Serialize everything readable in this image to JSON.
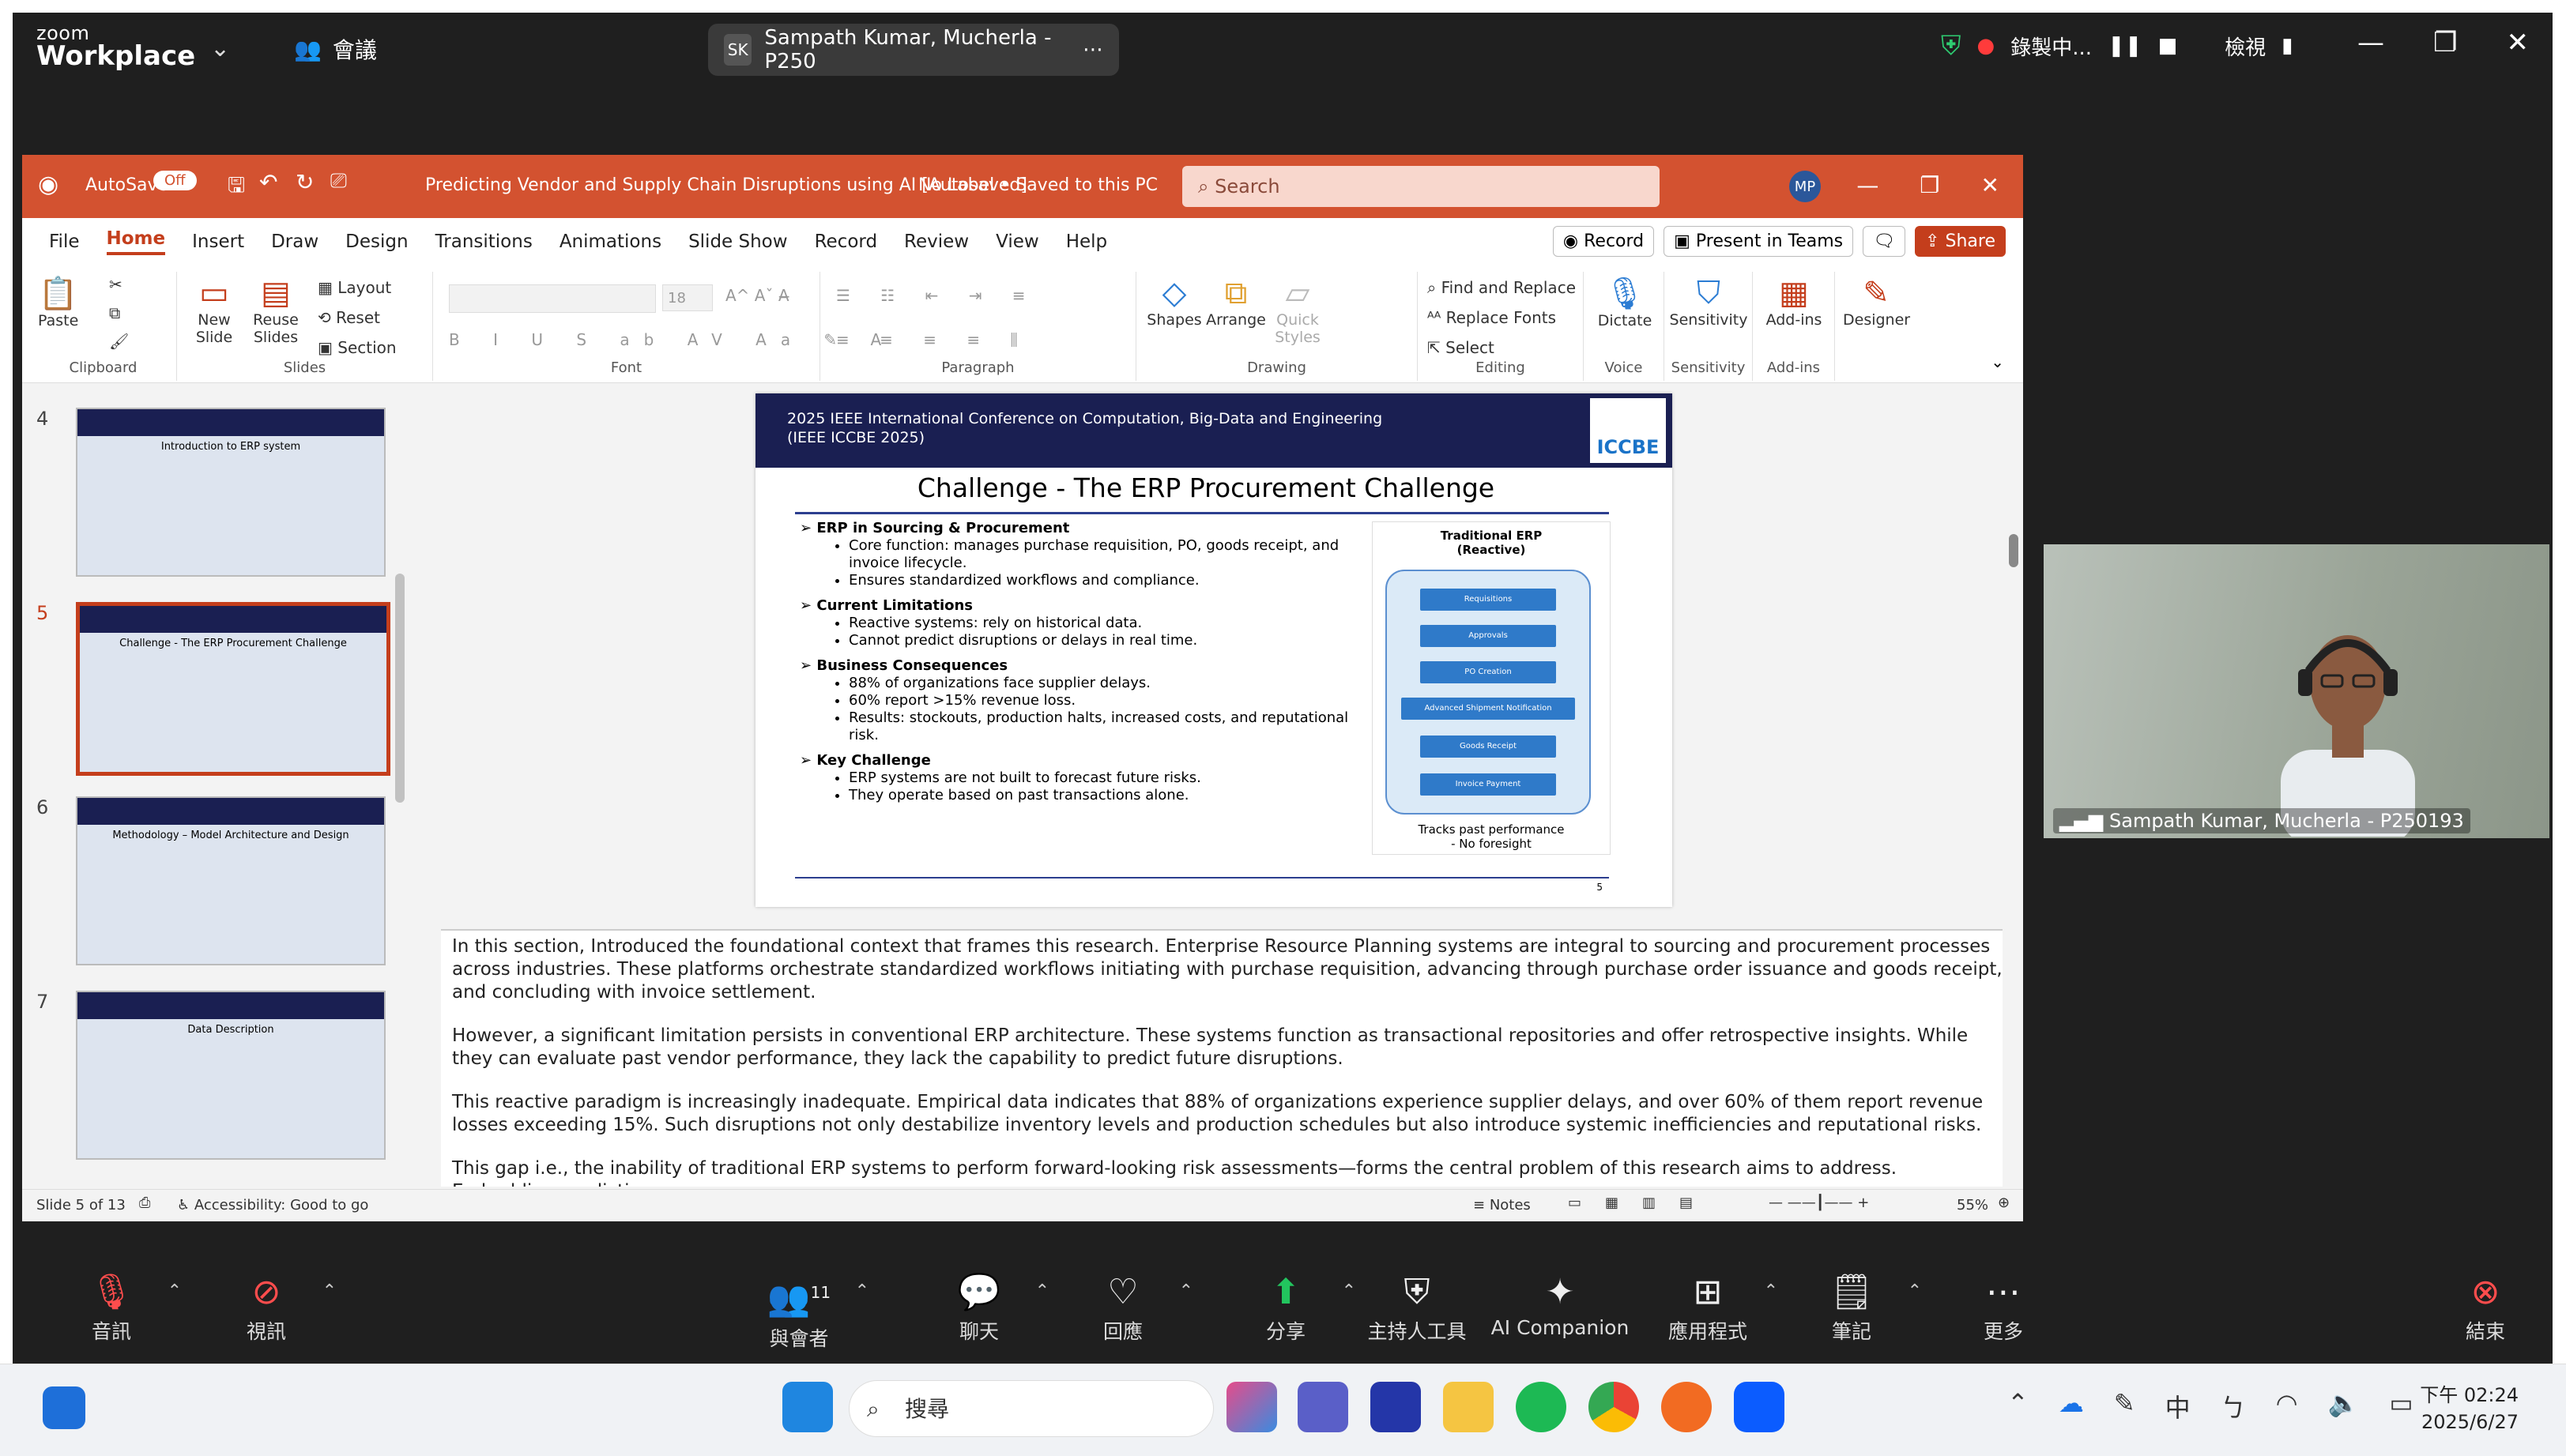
{
  "zoom": {
    "brand_small": "zoom",
    "brand_big": "Workplace",
    "meeting_label": "會議",
    "participant_initials": "SK",
    "participant_name": "Sampath Kumar, Mucherla - P250",
    "recording_label": "錄製中...",
    "view_label": "檢視"
  },
  "ppt": {
    "autosave_label": "AutoSave",
    "autosave_state": "Off",
    "doc_title": "Predicting Vendor and Supply Chain Disruptions using AI [Autosaved]",
    "label_status": "No Label • Saved to this PC",
    "search_placeholder": "Search",
    "user_initials": "MP",
    "menus": [
      "File",
      "Home",
      "Insert",
      "Draw",
      "Design",
      "Transitions",
      "Animations",
      "Slide Show",
      "Record",
      "Review",
      "View",
      "Help"
    ],
    "record_btn": "Record",
    "present_btn": "Present in Teams",
    "share_btn": "Share",
    "ribbon": {
      "paste": "Paste",
      "clipboard": "Clipboard",
      "new_slide": "New Slide",
      "reuse_slides": "Reuse Slides",
      "layout": "Layout",
      "reset": "Reset",
      "section": "Section",
      "slides": "Slides",
      "font_size": "18",
      "font": "Font",
      "paragraph": "Paragraph",
      "shapes": "Shapes",
      "arrange": "Arrange",
      "quick_styles": "Quick Styles",
      "drawing": "Drawing",
      "find_replace": "Find and Replace",
      "replace_fonts": "Replace Fonts",
      "select": "Select",
      "editing": "Editing",
      "dictate": "Dictate",
      "voice": "Voice",
      "sensitivity": "Sensitivity",
      "add_ins": "Add-ins",
      "designer": "Designer"
    },
    "thumbs": [
      {
        "num": "4",
        "title": "Introduction to ERP system"
      },
      {
        "num": "5",
        "title": "Challenge - The ERP Procurement Challenge"
      },
      {
        "num": "6",
        "title": "Methodology – Model Architecture and Design"
      },
      {
        "num": "7",
        "title": "Data Description"
      }
    ],
    "slide": {
      "conf_line1": "2025 IEEE International Conference on Computation, Big-Data and Engineering",
      "conf_line2": "(IEEE ICCBE 2025)",
      "logo": "ICCBE",
      "title": "Challenge - The ERP Procurement Challenge",
      "s1_head": "ERP in Sourcing & Procurement",
      "s1_b1": "Core function: manages purchase requisition, PO, goods receipt, and invoice lifecycle.",
      "s1_b2": "Ensures standardized workflows and compliance.",
      "s2_head": "Current Limitations",
      "s2_b1": "Reactive systems: rely on historical data.",
      "s2_b2": "Cannot predict disruptions or delays in real time.",
      "s3_head": "Business Consequences",
      "s3_b1": "88% of organizations face supplier delays.",
      "s3_b2": "60% report >15% revenue loss.",
      "s3_b3": "Results: stockouts, production halts, increased costs, and reputational risk.",
      "s4_head": "Key Challenge",
      "s4_b1": "ERP systems are not built to forecast future risks.",
      "s4_b2": "They operate based on past transactions alone.",
      "diag_title1": "Traditional ERP",
      "diag_title2": "(Reactive)",
      "steps": [
        "Requisitions",
        "Approvals",
        "PO Creation",
        "Advanced Shipment Notification",
        "Goods Receipt",
        "Invoice Payment"
      ],
      "diag_foot1": "Tracks past performance",
      "diag_foot2": "- No foresight",
      "page_num": "5"
    },
    "notes": [
      "In this section, Introduced the foundational context that frames this research. Enterprise Resource Planning systems are integral to sourcing and procurement processes across industries. These platforms orchestrate standardized workflows initiating with purchase requisition, advancing through purchase order issuance and goods receipt, and concluding with invoice settlement.",
      "However, a significant limitation persists in conventional ERP architecture. These systems function as transactional repositories and offer retrospective insights. While they can evaluate past vendor performance, they lack the capability to predict future disruptions.",
      "This reactive paradigm is increasingly inadequate. Empirical data indicates that 88% of organizations experience supplier delays, and over 60% of them report revenue losses exceeding 15%. Such disruptions not only destabilize inventory levels and production schedules but also introduce systemic inefficiencies and reputational risks.",
      "This gap i.e., the inability of traditional ERP systems to perform forward-looking risk assessments—forms the central problem of this research aims to address. Embedding predictive"
    ],
    "status_slide": "Slide 5 of 13",
    "status_access": "Accessibility: Good to go",
    "status_notes": "Notes",
    "zoom_pct": "55%"
  },
  "video": {
    "name": "Sampath Kumar, Mucherla - P250193"
  },
  "toolbar": {
    "audio": "音訊",
    "video": "視訊",
    "participants": "與會者",
    "participants_count": "11",
    "chat": "聊天",
    "react": "回應",
    "share": "分享",
    "host_tools": "主持人工具",
    "ai_companion": "AI Companion",
    "apps": "應用程式",
    "notes": "筆記",
    "more": "更多",
    "end": "結束"
  },
  "taskbar": {
    "search": "搜尋",
    "ime": "中",
    "time": "下午 02:24",
    "date": "2025/6/27"
  }
}
